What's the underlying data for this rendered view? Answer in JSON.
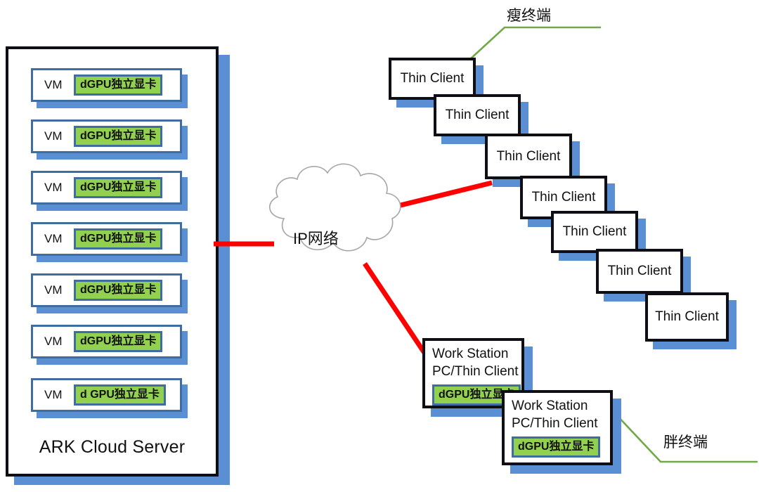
{
  "diagram": {
    "title_text": "ARK Cloud Server",
    "server": {
      "label": "ARK Cloud Server",
      "vms": [
        {
          "name": "VM",
          "gpu": "dGPU独立显卡"
        },
        {
          "name": "VM",
          "gpu": "dGPU独立显卡"
        },
        {
          "name": "VM",
          "gpu": "dGPU独立显卡"
        },
        {
          "name": "VM",
          "gpu": "dGPU独立显卡"
        },
        {
          "name": "VM",
          "gpu": "dGPU独立显卡"
        },
        {
          "name": "VM",
          "gpu": "dGPU独立显卡"
        },
        {
          "name": "VM",
          "gpu": "d GPU独立显卡"
        }
      ]
    },
    "network": {
      "label": "IP网络"
    },
    "thin_clients": [
      {
        "label": "Thin Client"
      },
      {
        "label": "Thin Client"
      },
      {
        "label": "Thin Client"
      },
      {
        "label": "Thin Client"
      },
      {
        "label": "Thin Client"
      },
      {
        "label": "Thin Client"
      },
      {
        "label": "Thin Client"
      }
    ],
    "work_stations": [
      {
        "line1": "Work Station",
        "line2": "PC/Thin Client",
        "gpu": "dGPU独立显卡"
      },
      {
        "line1": "Work Station",
        "line2": "PC/Thin Client",
        "gpu": "dGPU独立显卡"
      }
    ],
    "annotations": {
      "thin_terminal": "瘦终端",
      "fat_terminal": "胖终端"
    },
    "colors": {
      "shadow_blue": "#5B8FD4",
      "vm_border_blue": "#3F6DA0",
      "gpu_green": "#92D050",
      "link_red": "#FF0000",
      "leader_green": "#70A848",
      "box_black": "#0e0e14",
      "cloud_outline": "#A6A6A6"
    }
  }
}
